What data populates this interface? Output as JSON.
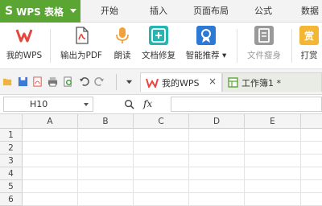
{
  "app": {
    "name": "WPS 表格",
    "logo": "S"
  },
  "menu_tabs": [
    "开始",
    "插入",
    "页面布局",
    "公式",
    "数据"
  ],
  "ribbon": {
    "buttons": [
      {
        "label": "我的WPS",
        "icon": "wps-logo-icon",
        "color": "#e8453c"
      },
      {
        "label": "输出为PDF",
        "icon": "pdf-icon",
        "color": "#e8453c"
      },
      {
        "label": "朗读",
        "icon": "microphone-icon",
        "color": "#f2a23c"
      },
      {
        "label": "文档修复",
        "icon": "repair-icon",
        "color": "#26b5b0"
      },
      {
        "label": "智能推荐",
        "icon": "badge-icon",
        "color": "#2d79d6"
      },
      {
        "label": "文件瘦身",
        "icon": "file-slim-icon",
        "color": "#9a9a9a"
      },
      {
        "label": "打赏",
        "icon": "reward-icon",
        "color": "#f3b733"
      }
    ],
    "reward_glyph": "赏"
  },
  "doc_tabs": [
    {
      "label": "我的WPS",
      "icon": "wps-logo-icon"
    },
    {
      "label": "工作簿1 *",
      "icon": "spreadsheet-icon"
    }
  ],
  "formula_bar": {
    "cell_ref": "H10",
    "fx_label": "fx",
    "value": ""
  },
  "sheet": {
    "columns": [
      "A",
      "B",
      "C",
      "D",
      "E"
    ],
    "rows": [
      "1",
      "2",
      "3",
      "4",
      "5",
      "6"
    ]
  },
  "colors": {
    "accent": "#5ba633"
  }
}
